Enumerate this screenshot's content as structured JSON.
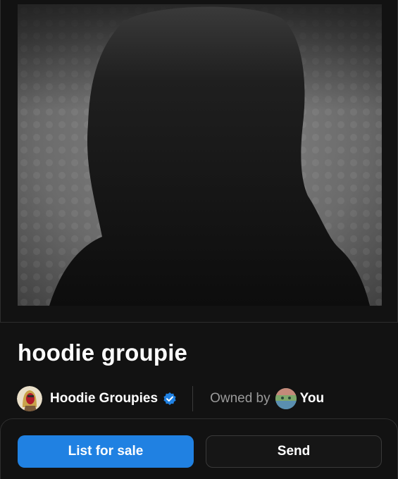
{
  "nft": {
    "title": "hoodie groupie",
    "image_icon": "hooded-figure-silhouette"
  },
  "collection": {
    "name": "Hoodie Groupies",
    "verified_icon": "verified-badge-icon",
    "avatar_icon": "collection-avatar"
  },
  "ownership": {
    "label": "Owned by",
    "owner": "You",
    "owner_avatar_icon": "owner-avatar"
  },
  "actions": {
    "list_for_sale": "List for sale",
    "send": "Send"
  },
  "colors": {
    "primary_button": "#2081e2",
    "background": "#121212",
    "verified_badge": "#2081e2"
  }
}
